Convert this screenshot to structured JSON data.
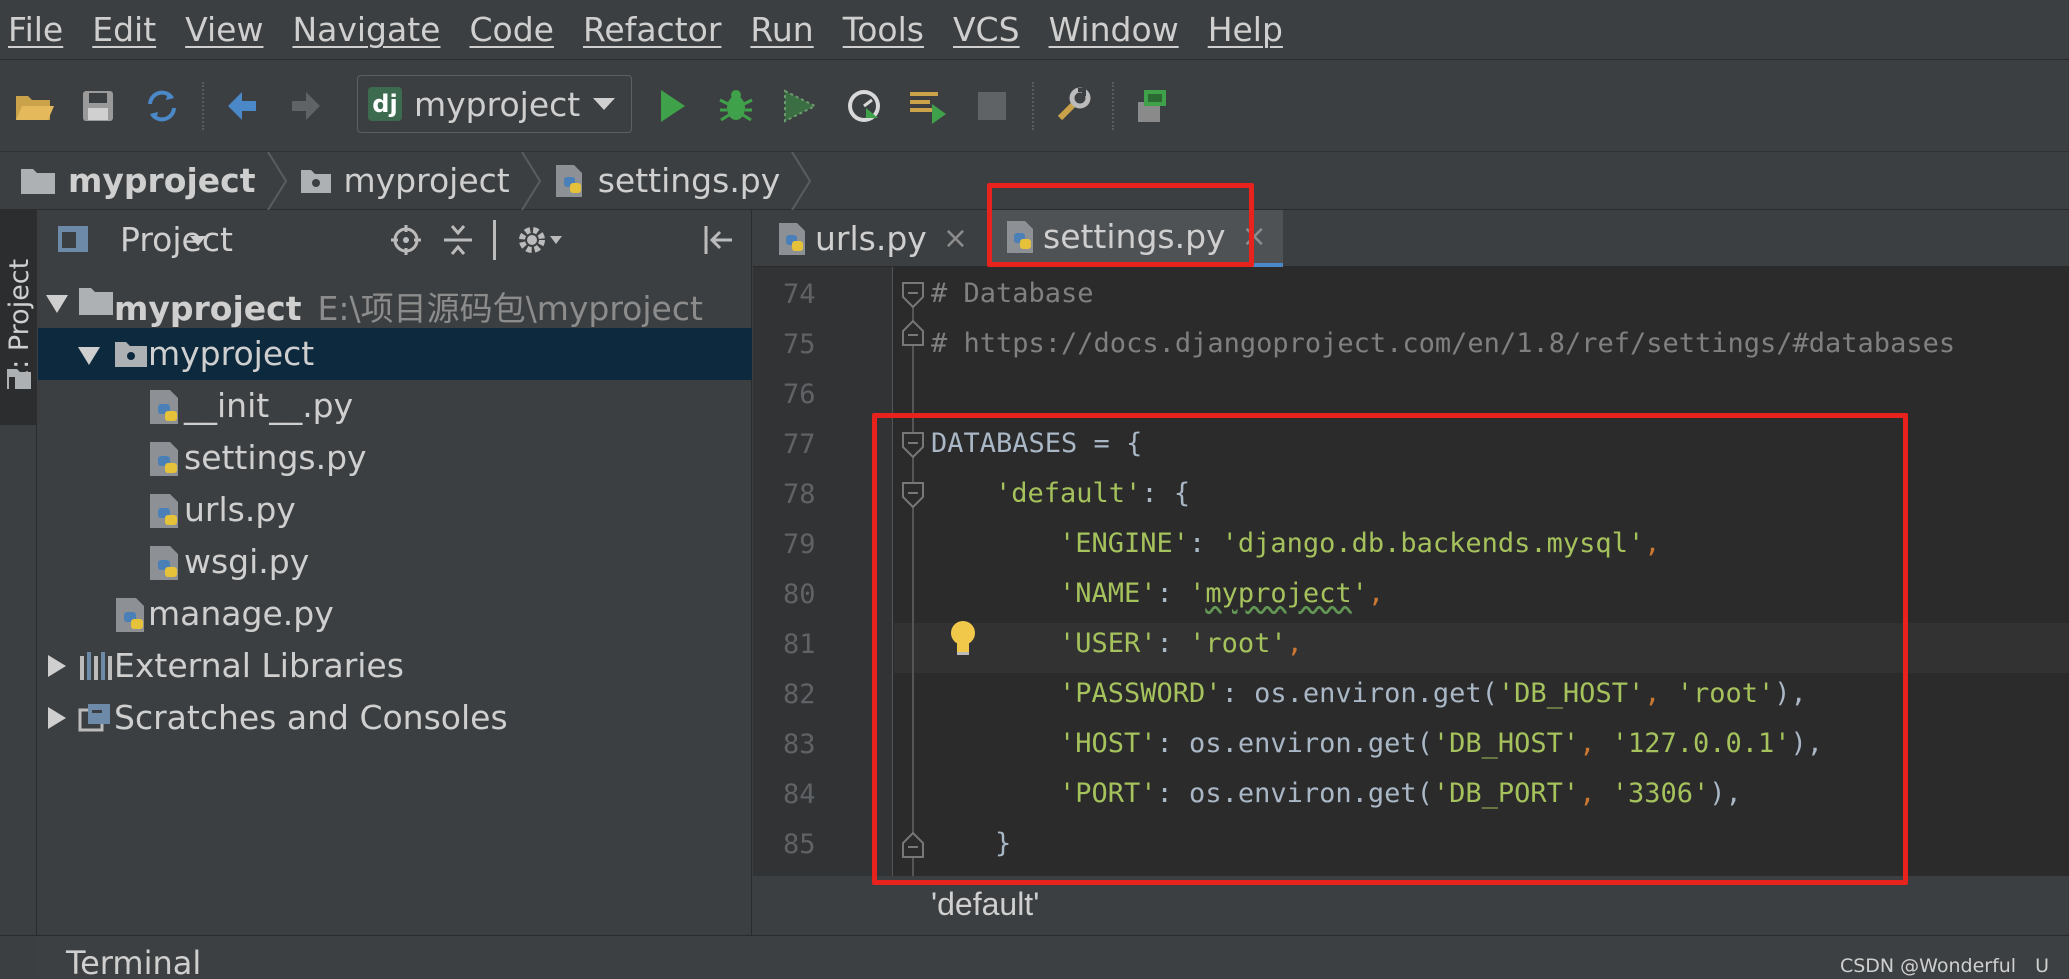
{
  "menu": [
    "File",
    "Edit",
    "View",
    "Navigate",
    "Code",
    "Refactor",
    "Run",
    "Tools",
    "VCS",
    "Window",
    "Help"
  ],
  "toolbar": {
    "run_config": "myproject",
    "run_config_badge": "dj",
    "icons": [
      "open-folder-icon",
      "save-icon",
      "sync-icon",
      "back-icon",
      "forward-icon",
      "run-icon",
      "debug-icon",
      "coverage-icon",
      "profile-icon",
      "concurrency-icon",
      "stop-icon",
      "settings-wrench-icon",
      "sdk-icon"
    ],
    "colors": {
      "run": "#3fa14a",
      "back": "#4a88c7"
    }
  },
  "breadcrumb": [
    "myproject",
    "myproject",
    "settings.py"
  ],
  "left_strip": {
    "tab_label": "1: Project"
  },
  "project_panel": {
    "title": "Project",
    "tree": [
      {
        "label": "myproject",
        "path": "E:\\项目源码包\\myproject",
        "type": "root-folder",
        "expanded": true
      },
      {
        "label": "myproject",
        "type": "package",
        "expanded": true,
        "selected": true
      },
      {
        "label": "__init__.py",
        "type": "python-file"
      },
      {
        "label": "settings.py",
        "type": "python-file"
      },
      {
        "label": "urls.py",
        "type": "python-file"
      },
      {
        "label": "wsgi.py",
        "type": "python-file"
      },
      {
        "label": "manage.py",
        "type": "python-file"
      },
      {
        "label": "External Libraries",
        "type": "libraries",
        "expanded": false
      },
      {
        "label": "Scratches and Consoles",
        "type": "scratches",
        "expanded": false
      }
    ]
  },
  "editor": {
    "tabs": [
      {
        "label": "urls.py",
        "active": false
      },
      {
        "label": "settings.py",
        "active": true
      }
    ],
    "close_glyph": "×",
    "line_numbers": [
      "74",
      "75",
      "76",
      "77",
      "78",
      "79",
      "80",
      "81",
      "82",
      "83",
      "84",
      "85"
    ],
    "code": {
      "l74": "# Database",
      "l75": "# https://docs.djangoproject.com/en/1.8/ref/settings/#databases",
      "l77a": "DATABASES = {",
      "l78a": "'default'",
      "l78b": ": {",
      "l79a": "'ENGINE'",
      "l79b": ": ",
      "l79c": "'django.db.backends.mysql'",
      "l79d": ",",
      "l80a": "'NAME'",
      "l80b": ": ",
      "l80c": "'",
      "l80d": "myproject",
      "l80e": "'",
      "l80f": ",",
      "l81a": "'USER'",
      "l81b": ": ",
      "l81c": "'root'",
      "l81d": ",",
      "l82a": "'PASSWORD'",
      "l82b": ": os.environ.get(",
      "l82c": "'DB_HOST'",
      "l82d": ", ",
      "l82e": "'root'",
      "l82f": "),",
      "l83a": "'HOST'",
      "l83b": ": os.environ.get(",
      "l83c": "'DB_HOST'",
      "l83d": ", ",
      "l83e": "'127.0.0.1'",
      "l83f": "),",
      "l84a": "'PORT'",
      "l84b": ": os.environ.get(",
      "l84c": "'DB_PORT'",
      "l84d": ", ",
      "l84e": "'3306'",
      "l84f": "),",
      "l85": "}"
    },
    "hint": "'default'"
  },
  "bottom": {
    "terminal_label": "Terminal",
    "watermark": "CSDN @Wonderful　U"
  },
  "highlight_color": "#e8231d"
}
